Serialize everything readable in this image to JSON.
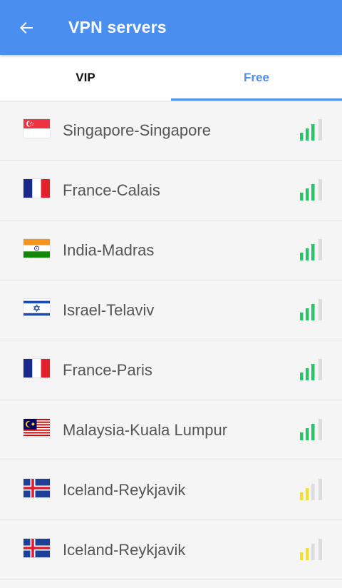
{
  "header": {
    "title": "VPN servers",
    "back_icon": "arrow-left-icon",
    "background": "#4a8ff0"
  },
  "tabs": [
    {
      "label": "VIP",
      "active": false
    },
    {
      "label": "Free",
      "active": true
    }
  ],
  "colors": {
    "accent": "#4a8ff0",
    "signal_strong": "#27c46b",
    "signal_medium": "#f2e12a",
    "signal_empty": "#dcdcdc"
  },
  "servers": [
    {
      "name": "Singapore-Singapore",
      "flag": "singapore-flag-icon",
      "signal_bars": 3,
      "signal_color": "#27c46b"
    },
    {
      "name": "France-Calais",
      "flag": "france-flag-icon",
      "signal_bars": 3,
      "signal_color": "#27c46b"
    },
    {
      "name": "India-Madras",
      "flag": "india-flag-icon",
      "signal_bars": 3,
      "signal_color": "#27c46b"
    },
    {
      "name": "Israel-Telaviv",
      "flag": "israel-flag-icon",
      "signal_bars": 3,
      "signal_color": "#27c46b"
    },
    {
      "name": "France-Paris",
      "flag": "france-flag-icon",
      "signal_bars": 3,
      "signal_color": "#27c46b"
    },
    {
      "name": "Malaysia-Kuala Lumpur",
      "flag": "malaysia-flag-icon",
      "signal_bars": 3,
      "signal_color": "#27c46b"
    },
    {
      "name": "Iceland-Reykjavik",
      "flag": "iceland-flag-icon",
      "signal_bars": 2,
      "signal_color": "#f2e12a"
    },
    {
      "name": "Iceland-Reykjavik",
      "flag": "iceland-flag-icon",
      "signal_bars": 2,
      "signal_color": "#f2e12a"
    }
  ]
}
